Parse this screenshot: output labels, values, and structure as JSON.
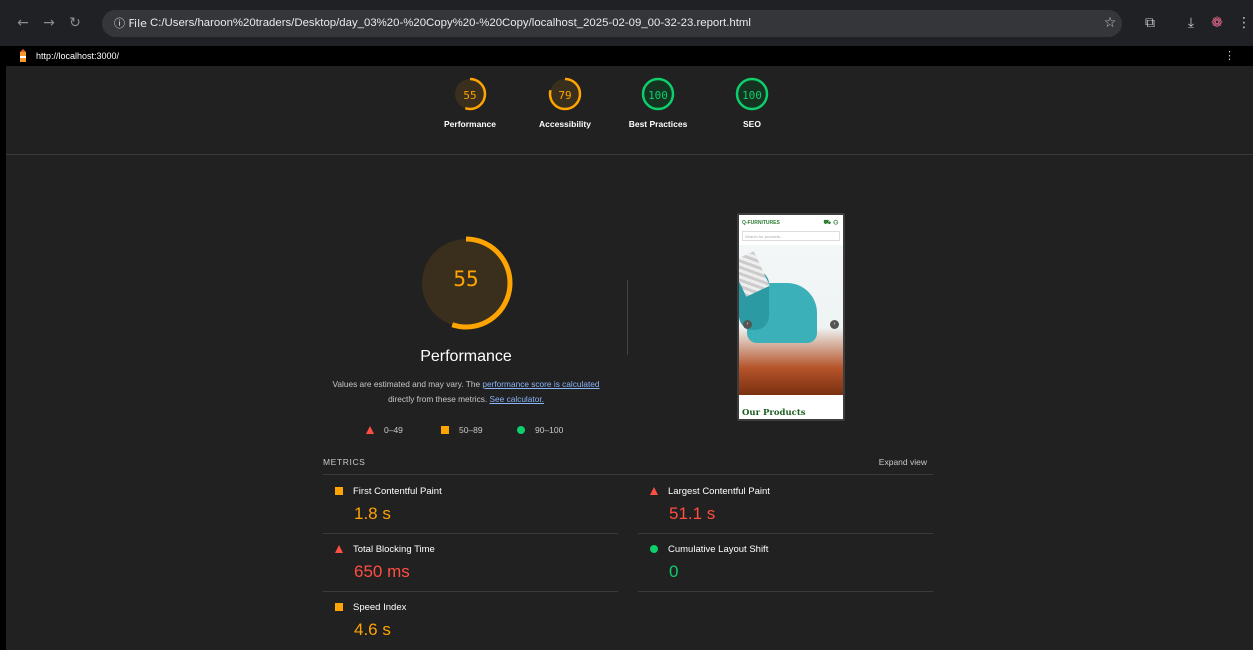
{
  "browser": {
    "file_chip": "ⓘ File",
    "address": "C:/Users/haroon%20traders/Desktop/day_03%20-%20Copy%20-%20Copy/localhost_2025-02-09_00-32-23.report.html"
  },
  "lighthouse": {
    "url": "http://localhost:3000/"
  },
  "scores": [
    {
      "value": "55",
      "label": "Performance",
      "score": 55,
      "color": "#ffa400"
    },
    {
      "value": "79",
      "label": "Accessibility",
      "score": 79,
      "color": "#ffa400"
    },
    {
      "value": "100",
      "label": "Best Practices",
      "score": 100,
      "color": "#0cce6b"
    },
    {
      "value": "100",
      "label": "SEO",
      "score": 100,
      "color": "#0cce6b"
    }
  ],
  "performance": {
    "score": "55",
    "score_num": 55,
    "title": "Performance",
    "desc_1": "Values are estimated and may vary. The ",
    "desc_link_1": "performance score is calculated",
    "desc_2": " directly from these metrics. ",
    "desc_link_2": "See calculator."
  },
  "legend": {
    "fail": "0–49",
    "average": "50–89",
    "pass": "90–100"
  },
  "screenshot": {
    "brand": "Q-FURNITURES",
    "search_placeholder": "Search for products...",
    "heading": "Our Products"
  },
  "metrics": {
    "header": "METRICS",
    "expand": "Expand view",
    "items": [
      {
        "label": "First Contentful Paint",
        "value": "1.8 s",
        "rating": "average",
        "color": "#ffa400"
      },
      {
        "label": "Largest Contentful Paint",
        "value": "51.1 s",
        "rating": "fail",
        "color": "#ff4e42"
      },
      {
        "label": "Total Blocking Time",
        "value": "650 ms",
        "rating": "fail",
        "color": "#ff4e42"
      },
      {
        "label": "Cumulative Layout Shift",
        "value": "0",
        "rating": "pass",
        "color": "#0cce6b"
      },
      {
        "label": "Speed Index",
        "value": "4.6 s",
        "rating": "average",
        "color": "#ffa400"
      }
    ]
  }
}
